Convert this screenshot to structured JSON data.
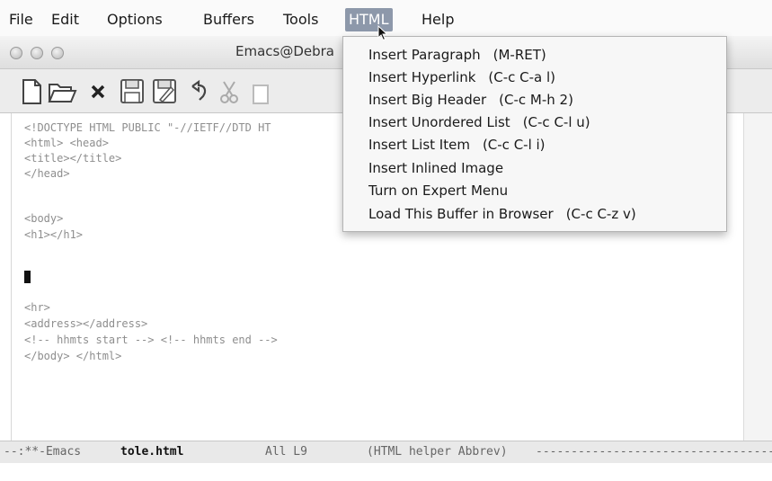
{
  "menubar": {
    "items": [
      "File",
      "Edit",
      "Options",
      "Buffers",
      "Tools",
      "HTML",
      "Help"
    ],
    "active": "HTML"
  },
  "window": {
    "title": "Emacs@Debra"
  },
  "toolbar": {
    "buttons": [
      "new-file-icon",
      "open-folder-icon",
      "close-x-icon",
      "save-icon",
      "save-as-icon",
      "undo-icon",
      "cut-icon",
      "copy-icon"
    ]
  },
  "editor": {
    "lines": [
      "<!DOCTYPE HTML PUBLIC \"-//IETF//DTD HT",
      "<html> <head>",
      "<title></title>",
      "</head>",
      "",
      "<body>",
      "<h1></h1>",
      "",
      "",
      "",
      "<hr>",
      "<address></address>",
      "<!-- hhmts start --> <!-- hhmts end -->",
      "</body> </html>"
    ]
  },
  "modeline": {
    "prefix": "--:**-Emacs",
    "buffer": "tole.html",
    "position": "All L9",
    "mode": "(HTML helper Abbrev)"
  },
  "dropdown": {
    "items": [
      {
        "label": "Insert Paragraph",
        "shortcut": "(M-RET)"
      },
      {
        "label": "Insert Hyperlink",
        "shortcut": "(C-c C-a l)"
      },
      {
        "label": "Insert Big Header",
        "shortcut": "(C-c M-h 2)"
      },
      {
        "label": "Insert Unordered List",
        "shortcut": "(C-c C-l u)"
      },
      {
        "label": "Insert List Item",
        "shortcut": "(C-c C-l i)"
      },
      {
        "label": "Insert Inlined Image",
        "shortcut": ""
      },
      {
        "label": "Turn on Expert Menu",
        "shortcut": ""
      },
      {
        "label": "Load This Buffer in Browser",
        "shortcut": "(C-c C-z v)"
      }
    ]
  },
  "colors": {
    "menu_highlight": "#8d98aa",
    "code_text": "#8e8e8e"
  }
}
